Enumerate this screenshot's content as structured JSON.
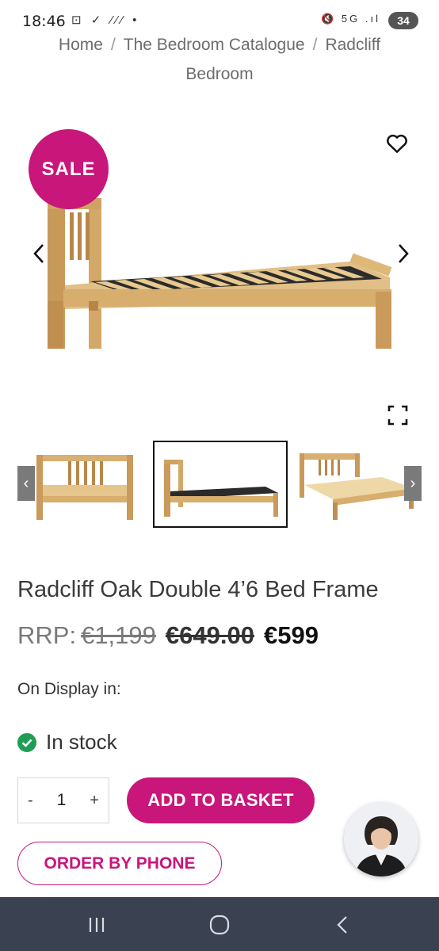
{
  "status_bar": {
    "time": "18:46",
    "left_icons": "⊡ ✓ ⁄⁄⁄ •",
    "right_icons": "🔇 5G .ıl",
    "battery": "34"
  },
  "breadcrumb": {
    "items": [
      "Home",
      "The Bedroom Catalogue",
      "Radcliff Bedroom"
    ],
    "separator": "/"
  },
  "gallery": {
    "sale_badge": "SALE",
    "icons": {
      "wishlist": "heart-icon",
      "prev": "chevron-left-icon",
      "next": "chevron-right-icon",
      "fullscreen": "fullscreen-icon"
    },
    "thumb_prev": "‹",
    "thumb_next": "›",
    "selected_thumbnail": 2,
    "thumbnail_count": 3
  },
  "product": {
    "title": "Radcliff Oak Double 4’6 Bed Frame",
    "rrp_label": "RRP:",
    "rrp_value": "€1,199",
    "old_price": "€649.00",
    "price": "€599",
    "on_display_label": "On Display in:",
    "stock_status": "In stock"
  },
  "purchase": {
    "qty_minus": "-",
    "qty_value": "1",
    "qty_plus": "+",
    "add_to_basket": "ADD TO BASKET",
    "order_by_phone": "ORDER BY PHONE"
  },
  "colors": {
    "brand": "#c8167a",
    "in_stock": "#1f9d55",
    "nav_bar": "#3a4150"
  }
}
